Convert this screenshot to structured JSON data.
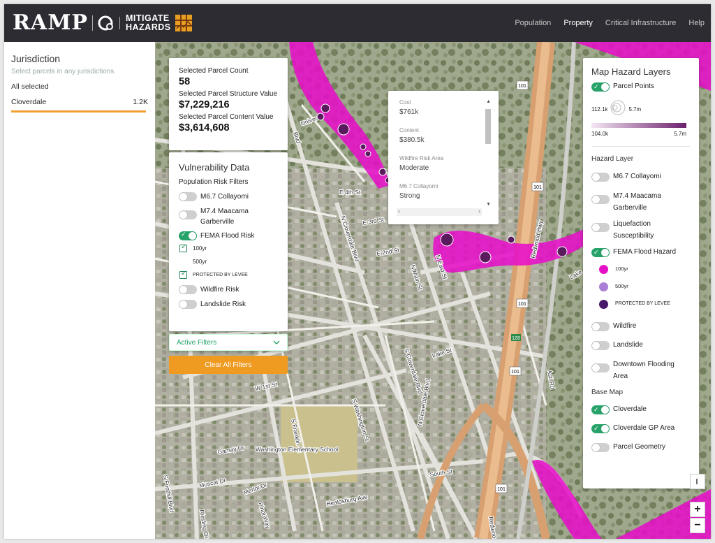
{
  "header": {
    "brand": "RAMP",
    "product_line1": "MITIGATE",
    "product_line2": "HAZARDS",
    "nav": [
      {
        "label": "Population",
        "active": false
      },
      {
        "label": "Property",
        "active": true
      },
      {
        "label": "Critical Infrastructure",
        "active": false
      },
      {
        "label": "Help",
        "active": false
      }
    ]
  },
  "sidebar": {
    "title": "Jurisdiction",
    "subtitle": "Select parcels in any jurisdictions",
    "all_label": "All selected",
    "item_name": "Cloverdale",
    "item_count": "1.2K"
  },
  "stats": {
    "count_label": "Selected Parcel Count",
    "count_value": "58",
    "structure_label": "Selected Parcel Structure Value",
    "structure_value": "$7,229,216",
    "content_label": "Selected Parcel Content Value",
    "content_value": "$3,614,608"
  },
  "vulnerability": {
    "title": "Vulnerability Data",
    "subtitle": "Population Risk Filters",
    "m67": {
      "label": "M6.7 Collayomi",
      "on": false
    },
    "m74": {
      "label": "M7.4 Maacama Garberville",
      "on": false
    },
    "fema": {
      "label": "FEMA Flood Risk",
      "on": true
    },
    "yr100": {
      "label": "100yr",
      "checked": true
    },
    "yr500": {
      "label": "500yr",
      "checked": false
    },
    "levee": {
      "label": "PROTECTED BY LEVEE",
      "checked": true
    },
    "wildfire": {
      "label": "Wildfire Risk",
      "on": false
    },
    "landslide": {
      "label": "Landslide Risk",
      "on": false
    }
  },
  "filters": {
    "active_label": "Active Filters",
    "clear_label": "Clear All Filters"
  },
  "popup": {
    "fields": [
      {
        "label": "Cost",
        "value": "$761k"
      },
      {
        "label": "Content",
        "value": "$380.5k"
      },
      {
        "label": "Wildfire Risk Area",
        "value": "Moderate"
      },
      {
        "label": "M6.7 Collayomi",
        "value": "Strong"
      }
    ]
  },
  "layers": {
    "title": "Map Hazard Layers",
    "parcel_points": "Parcel Points",
    "legend_min_circle": "112.1k",
    "legend_max_circle": "5.7m",
    "legend_min_bar": "104.0k",
    "legend_max_bar": "5.7m",
    "hazard_section": "Hazard Layer",
    "m67": "M6.7 Collayomi",
    "m74_a": "M7.4 Maacama",
    "m74_b": "Garberville",
    "liq_a": "Liquefaction",
    "liq_b": "Susceptibility",
    "fema": "FEMA Flood Hazard",
    "f100": "100yr",
    "f500": "500yr",
    "flevee": "PROTECTED BY LEVEE",
    "wildfire": "Wildfire",
    "landslide": "Landslide",
    "downtown_a": "Downtown Flooding",
    "downtown_b": "Area",
    "base_section": "Base Map",
    "cloverdale": "Cloverdale",
    "cloverdale_gp": "Cloverdale GP Area",
    "parcel_geom": "Parcel Geometry"
  },
  "map_labels": {
    "e4th": "E 4th St",
    "e3rd": "E 3rd St",
    "e2nd": "E 2nd St",
    "n_cloverdale": "N Cloverdale Blvd",
    "s_cloverdale": "S Cloverdale Blvd",
    "n_cloverdale2": "N Cloverdale Blvd",
    "n_main": "N Main St",
    "n_east": "N East St",
    "redwood_hwy": "Redwood Hwy",
    "lake_st": "Lake St",
    "w1st": "W 1st St",
    "s_washington": "S Washington St",
    "s_franklin": "S Franklin St",
    "school": "Washington Elementary School",
    "gamay": "Gamay Dr",
    "muscat": "Muscat Dr",
    "merlot": "Merlot Dr",
    "healdsburg": "Healdsburg Ave",
    "south_st": "South St",
    "asti": "Asti Rd",
    "riesling": "Riesling Dr",
    "pinot": "Pinot Way",
    "s_foothill": "S Foothill Blvd",
    "redwood": "Redwood",
    "univer": "Univer",
    "blvd": "Blvd",
    "lake": "Lake",
    "r101a": "101",
    "r101b": "101",
    "r101c": "101",
    "r101d": "101",
    "r101e": "101",
    "r128": "128"
  },
  "colors": {
    "flood_100yr": "#e60fc8",
    "flood_500yr": "#a87fd4",
    "protected_levee": "#4a1a6a",
    "accent_orange": "#ef9a20",
    "toggle_on": "#27a36a"
  },
  "zoom": {
    "in": "+",
    "out": "−"
  }
}
